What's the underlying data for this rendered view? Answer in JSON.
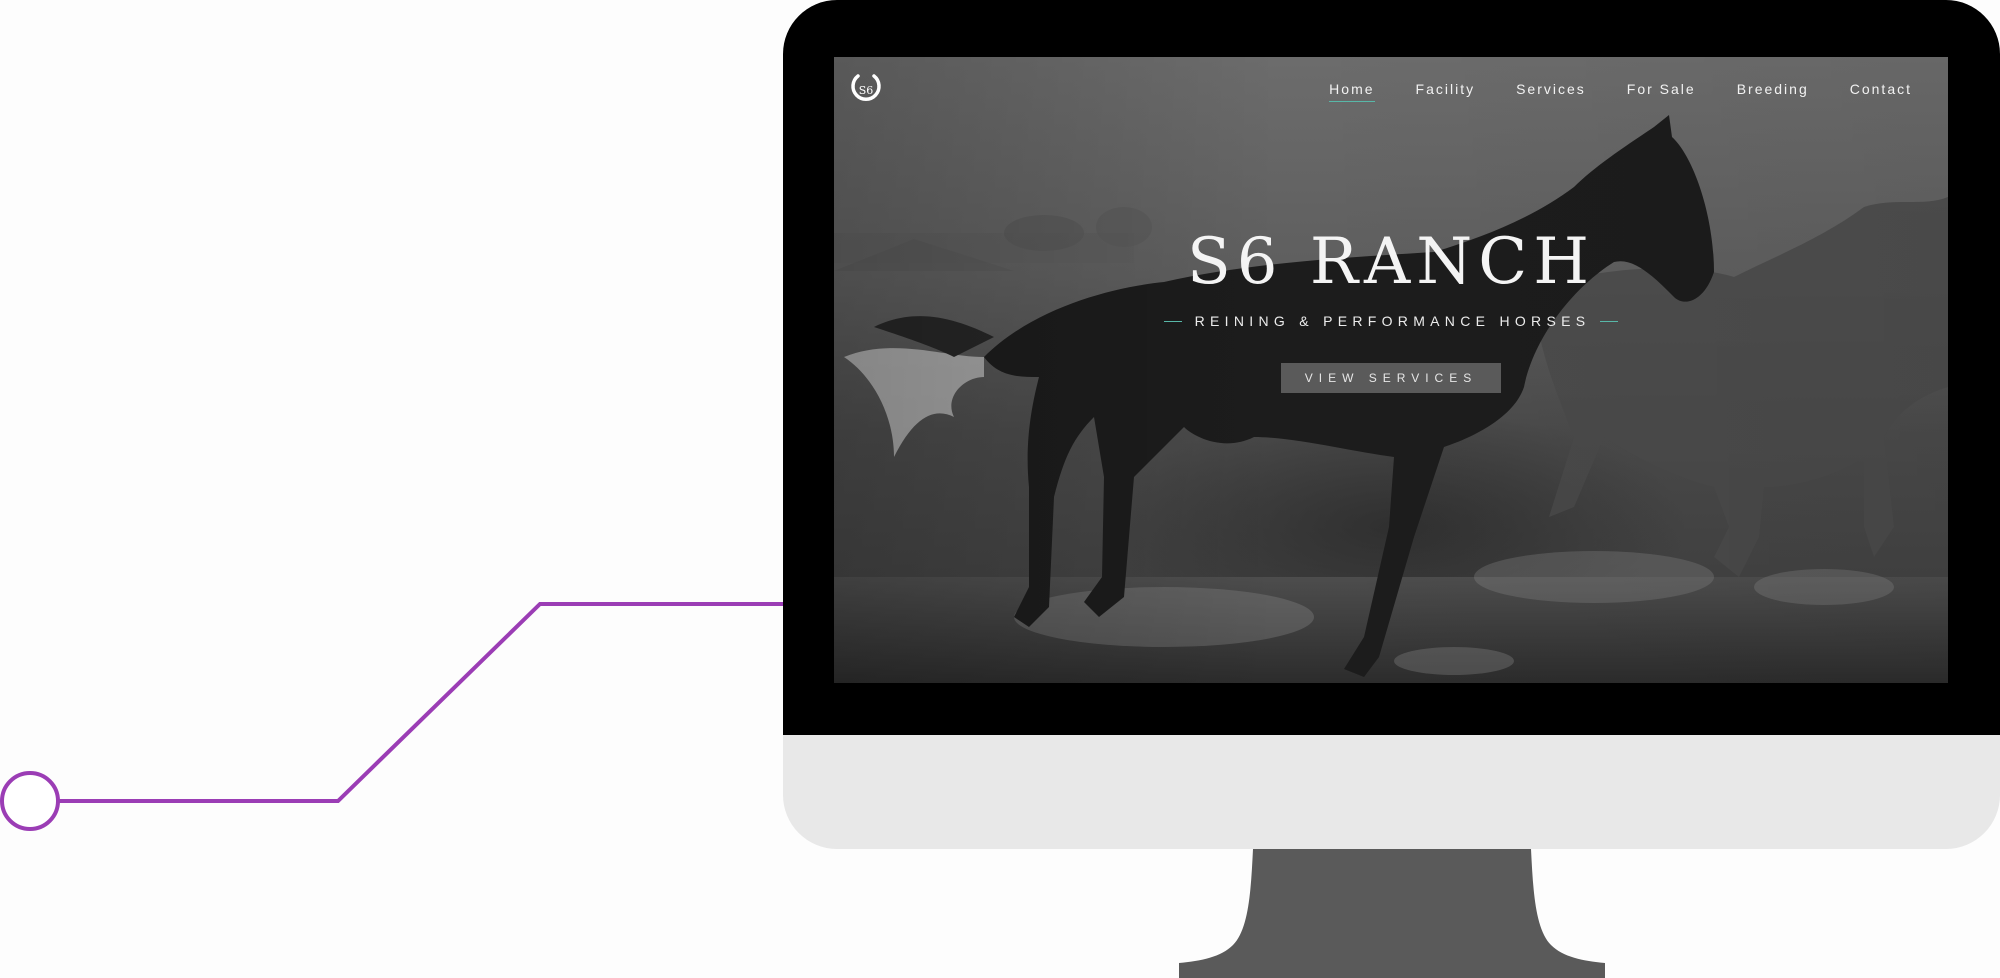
{
  "site": {
    "logo_text": "S6",
    "nav": [
      {
        "label": "Home",
        "active": true
      },
      {
        "label": "Facility",
        "active": false
      },
      {
        "label": "Services",
        "active": false
      },
      {
        "label": "For Sale",
        "active": false
      },
      {
        "label": "Breeding",
        "active": false
      },
      {
        "label": "Contact",
        "active": false
      }
    ],
    "hero": {
      "title": "S6 RANCH",
      "subtitle": "REINING & PERFORMANCE HORSES",
      "cta_label": "VIEW SERVICES"
    }
  },
  "colors": {
    "connector": "#9b3db5",
    "bezel": "#000000",
    "chin": "#e8e8e8",
    "stand": "#5a5a5a",
    "accent": "#58b7a8"
  }
}
